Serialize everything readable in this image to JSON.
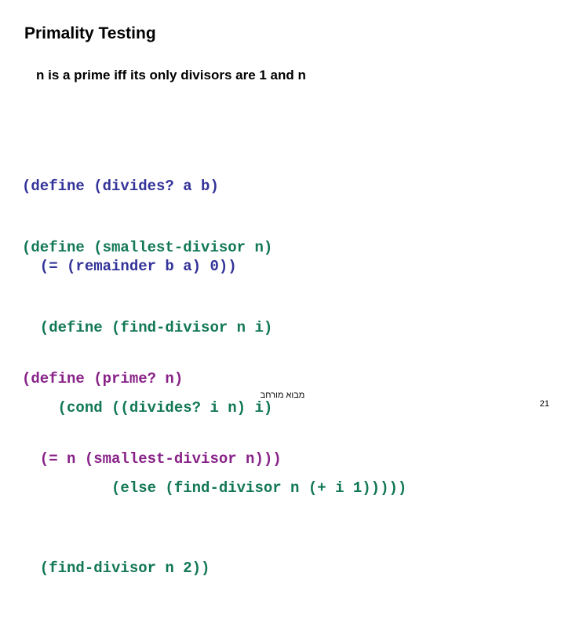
{
  "slide": {
    "title": "Primality Testing",
    "subtitle": "n is a prime iff its only divisors are 1 and n",
    "background_color": "#ffffff",
    "title_color": "#000000"
  },
  "code_blocks": [
    {
      "id": "divides",
      "color": "#333399",
      "lines": [
        "(define (divides? a b)",
        "  (= (remainder b a) 0))"
      ]
    },
    {
      "id": "smallest-divisor",
      "color": "#117755",
      "lines": [
        "(define (smallest-divisor n)",
        "  (define (find-divisor n i)",
        "    (cond ((divides? i n) i)",
        "          (else (find-divisor n (+ i 1)))))",
        "  (find-divisor n 2))"
      ]
    },
    {
      "id": "prime",
      "color": "#882288",
      "lines": [
        "(define (prime? n)",
        "  (= n (smallest-divisor n)))"
      ]
    }
  ],
  "footer": {
    "note": "מבוא מורחב",
    "page_number": "21"
  }
}
